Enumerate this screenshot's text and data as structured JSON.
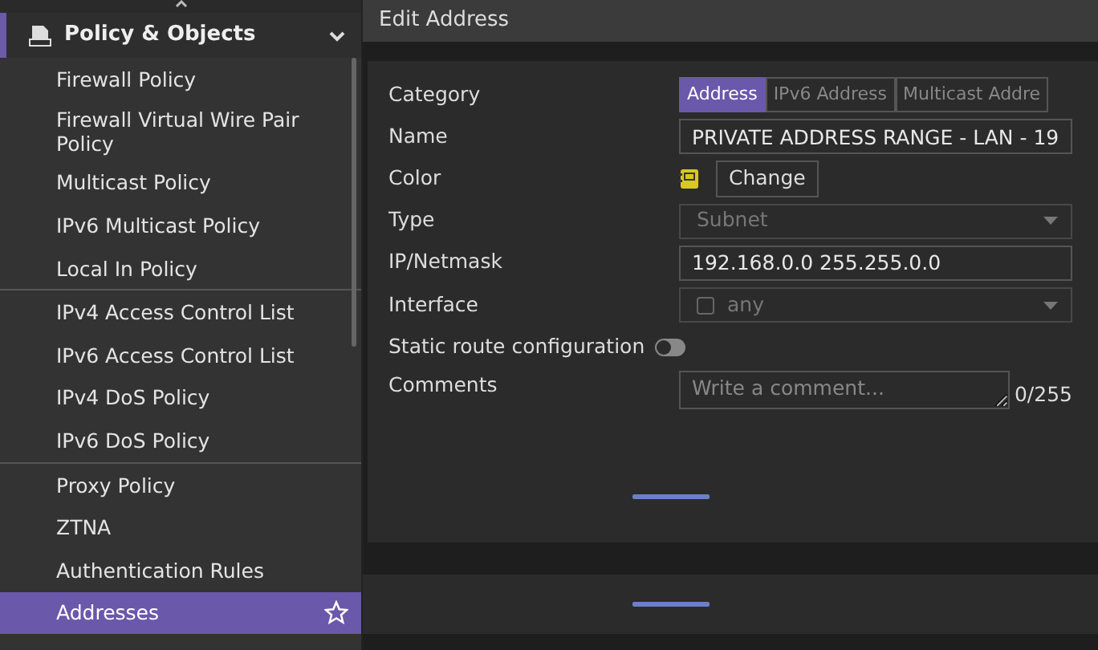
{
  "sidebar": {
    "section": {
      "label": "Policy & Objects",
      "expanded": true
    },
    "groups": [
      {
        "items": [
          {
            "label": "Firewall Policy",
            "selected": false
          },
          {
            "label": "Firewall Virtual Wire Pair Policy",
            "selected": false
          },
          {
            "label": "Multicast Policy",
            "selected": false
          },
          {
            "label": "IPv6 Multicast Policy",
            "selected": false
          },
          {
            "label": "Local In Policy",
            "selected": false
          }
        ]
      },
      {
        "items": [
          {
            "label": "IPv4 Access Control List",
            "selected": false
          },
          {
            "label": "IPv6 Access Control List",
            "selected": false
          },
          {
            "label": "IPv4 DoS Policy",
            "selected": false
          },
          {
            "label": "IPv6 DoS Policy",
            "selected": false
          }
        ]
      },
      {
        "items": [
          {
            "label": "Proxy Policy",
            "selected": false
          },
          {
            "label": "ZTNA",
            "selected": false
          },
          {
            "label": "Authentication Rules",
            "selected": false
          },
          {
            "label": "Addresses",
            "selected": true
          }
        ]
      }
    ]
  },
  "dialog": {
    "title": "Edit Address",
    "fields": [
      {
        "kind": "tabs",
        "label": "Category",
        "tabs": [
          {
            "label": "Address",
            "selected": true
          },
          {
            "label": "IPv6 Address",
            "selected": false
          },
          {
            "label": "Multicast Addre",
            "selected": false
          }
        ]
      },
      {
        "kind": "text",
        "label": "Name",
        "value": "PRIVATE ADDRESS RANGE - LAN - 19"
      },
      {
        "kind": "color",
        "label": "Color",
        "button": "Change"
      },
      {
        "kind": "select",
        "label": "Type",
        "value": "Subnet",
        "disabled": true
      },
      {
        "kind": "text",
        "label": "IP/Netmask",
        "value": "192.168.0.0 255.255.0.0"
      },
      {
        "kind": "select",
        "label": "Interface",
        "value": "any",
        "disabled": true,
        "checkbox": {
          "checked": false
        }
      },
      {
        "kind": "toggle",
        "label": "Static route configuration",
        "on": false
      },
      {
        "kind": "textarea",
        "label": "Comments",
        "placeholder": "Write a comment...",
        "counter": "0/255"
      }
    ]
  }
}
